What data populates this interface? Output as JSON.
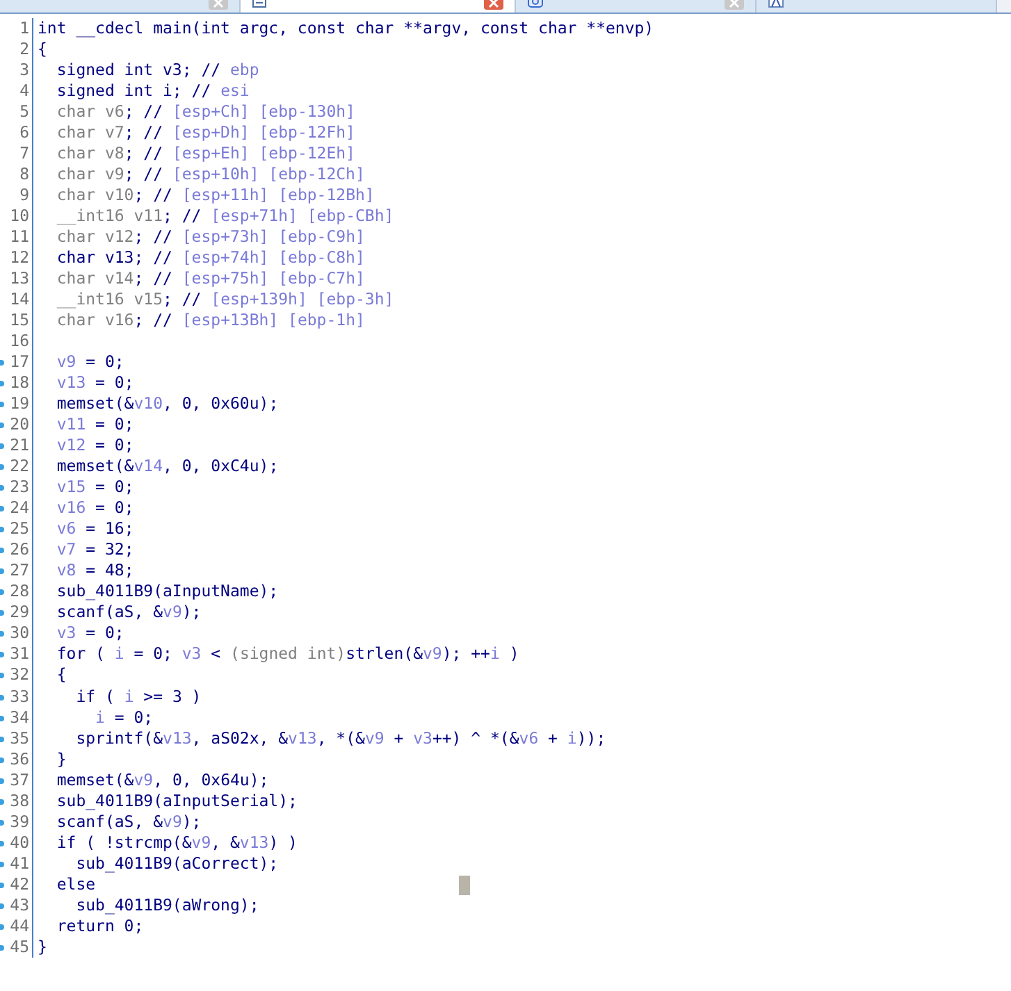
{
  "tabs": [
    {
      "selected": false
    },
    {
      "selected": true
    },
    {
      "selected": false
    },
    {
      "selected": false
    }
  ],
  "lines": [
    {
      "number": "1",
      "marked": false,
      "tokens": [
        {
          "kind": "code",
          "text": "int __cdecl main(int argc, const char **argv, const char **envp)"
        }
      ]
    },
    {
      "number": "2",
      "marked": false,
      "tokens": [
        {
          "kind": "code",
          "text": "{"
        }
      ]
    },
    {
      "number": "3",
      "marked": false,
      "tokens": [
        {
          "kind": "code",
          "text": "  signed int v3; // "
        },
        {
          "kind": "var",
          "text": "ebp"
        }
      ]
    },
    {
      "number": "4",
      "marked": false,
      "tokens": [
        {
          "kind": "code",
          "text": "  signed int i; // "
        },
        {
          "kind": "var",
          "text": "esi"
        }
      ]
    },
    {
      "number": "5",
      "marked": false,
      "tokens": [
        {
          "kind": "dim",
          "text": "  char v6"
        },
        {
          "kind": "code",
          "text": "; // "
        },
        {
          "kind": "var",
          "text": "[esp+Ch] [ebp-130h]"
        }
      ]
    },
    {
      "number": "6",
      "marked": false,
      "tokens": [
        {
          "kind": "dim",
          "text": "  char v7"
        },
        {
          "kind": "code",
          "text": "; // "
        },
        {
          "kind": "var",
          "text": "[esp+Dh] [ebp-12Fh]"
        }
      ]
    },
    {
      "number": "7",
      "marked": false,
      "tokens": [
        {
          "kind": "dim",
          "text": "  char v8"
        },
        {
          "kind": "code",
          "text": "; // "
        },
        {
          "kind": "var",
          "text": "[esp+Eh] [ebp-12Eh]"
        }
      ]
    },
    {
      "number": "8",
      "marked": false,
      "tokens": [
        {
          "kind": "dim",
          "text": "  char v9"
        },
        {
          "kind": "code",
          "text": "; // "
        },
        {
          "kind": "var",
          "text": "[esp+10h] [ebp-12Ch]"
        }
      ]
    },
    {
      "number": "9",
      "marked": false,
      "tokens": [
        {
          "kind": "dim",
          "text": "  char v10"
        },
        {
          "kind": "code",
          "text": "; // "
        },
        {
          "kind": "var",
          "text": "[esp+11h] [ebp-12Bh]"
        }
      ]
    },
    {
      "number": "10",
      "marked": false,
      "tokens": [
        {
          "kind": "dim",
          "text": "  __int16 v11"
        },
        {
          "kind": "code",
          "text": "; // "
        },
        {
          "kind": "var",
          "text": "[esp+71h] [ebp-CBh]"
        }
      ]
    },
    {
      "number": "11",
      "marked": false,
      "tokens": [
        {
          "kind": "dim",
          "text": "  char v12"
        },
        {
          "kind": "code",
          "text": "; // "
        },
        {
          "kind": "var",
          "text": "[esp+73h] [ebp-C9h]"
        }
      ]
    },
    {
      "number": "12",
      "marked": false,
      "tokens": [
        {
          "kind": "code",
          "text": "  char v13; // "
        },
        {
          "kind": "var",
          "text": "[esp+74h] [ebp-C8h]"
        }
      ]
    },
    {
      "number": "13",
      "marked": false,
      "tokens": [
        {
          "kind": "dim",
          "text": "  char v14"
        },
        {
          "kind": "code",
          "text": "; // "
        },
        {
          "kind": "var",
          "text": "[esp+75h] [ebp-C7h]"
        }
      ]
    },
    {
      "number": "14",
      "marked": false,
      "tokens": [
        {
          "kind": "dim",
          "text": "  __int16 v15"
        },
        {
          "kind": "code",
          "text": "; // "
        },
        {
          "kind": "var",
          "text": "[esp+139h] [ebp-3h]"
        }
      ]
    },
    {
      "number": "15",
      "marked": false,
      "tokens": [
        {
          "kind": "dim",
          "text": "  char v16"
        },
        {
          "kind": "code",
          "text": "; // "
        },
        {
          "kind": "var",
          "text": "[esp+13Bh] [ebp-1h]"
        }
      ]
    },
    {
      "number": "16",
      "marked": false
    },
    {
      "number": "17",
      "marked": true,
      "tokens": [
        {
          "kind": "var",
          "text": "  v9"
        },
        {
          "kind": "code",
          "text": " = 0;"
        }
      ]
    },
    {
      "number": "18",
      "marked": true,
      "tokens": [
        {
          "kind": "var",
          "text": "  v13"
        },
        {
          "kind": "code",
          "text": " = 0;"
        }
      ]
    },
    {
      "number": "19",
      "marked": true,
      "tokens": [
        {
          "kind": "code",
          "text": "  memset(&"
        },
        {
          "kind": "var",
          "text": "v10"
        },
        {
          "kind": "code",
          "text": ", 0, 0x60u);"
        }
      ]
    },
    {
      "number": "20",
      "marked": true,
      "tokens": [
        {
          "kind": "var",
          "text": "  v11"
        },
        {
          "kind": "code",
          "text": " = 0;"
        }
      ]
    },
    {
      "number": "21",
      "marked": true,
      "tokens": [
        {
          "kind": "var",
          "text": "  v12"
        },
        {
          "kind": "code",
          "text": " = 0;"
        }
      ]
    },
    {
      "number": "22",
      "marked": true,
      "tokens": [
        {
          "kind": "code",
          "text": "  memset(&"
        },
        {
          "kind": "var",
          "text": "v14"
        },
        {
          "kind": "code",
          "text": ", 0, 0xC4u);"
        }
      ]
    },
    {
      "number": "23",
      "marked": true,
      "tokens": [
        {
          "kind": "var",
          "text": "  v15"
        },
        {
          "kind": "code",
          "text": " = 0;"
        }
      ]
    },
    {
      "number": "24",
      "marked": true,
      "tokens": [
        {
          "kind": "var",
          "text": "  v16"
        },
        {
          "kind": "code",
          "text": " = 0;"
        }
      ]
    },
    {
      "number": "25",
      "marked": true,
      "tokens": [
        {
          "kind": "var",
          "text": "  v6"
        },
        {
          "kind": "code",
          "text": " = 16;"
        }
      ]
    },
    {
      "number": "26",
      "marked": true,
      "tokens": [
        {
          "kind": "var",
          "text": "  v7"
        },
        {
          "kind": "code",
          "text": " = 32;"
        }
      ]
    },
    {
      "number": "27",
      "marked": true,
      "tokens": [
        {
          "kind": "var",
          "text": "  v8"
        },
        {
          "kind": "code",
          "text": " = 48;"
        }
      ]
    },
    {
      "number": "28",
      "marked": true,
      "tokens": [
        {
          "kind": "code",
          "text": "  sub_4011B9(aInputName);"
        }
      ]
    },
    {
      "number": "29",
      "marked": true,
      "tokens": [
        {
          "kind": "code",
          "text": "  scanf(aS, &"
        },
        {
          "kind": "var",
          "text": "v9"
        },
        {
          "kind": "code",
          "text": ");"
        }
      ]
    },
    {
      "number": "30",
      "marked": true,
      "tokens": [
        {
          "kind": "var",
          "text": "  v3"
        },
        {
          "kind": "code",
          "text": " = 0;"
        }
      ]
    },
    {
      "number": "31",
      "marked": true,
      "tokens": [
        {
          "kind": "code",
          "text": "  for ( "
        },
        {
          "kind": "var",
          "text": "i"
        },
        {
          "kind": "code",
          "text": " = 0; "
        },
        {
          "kind": "var",
          "text": "v3"
        },
        {
          "kind": "code",
          "text": " < "
        },
        {
          "kind": "dim",
          "text": "(signed int)"
        },
        {
          "kind": "code",
          "text": "strlen(&"
        },
        {
          "kind": "var",
          "text": "v9"
        },
        {
          "kind": "code",
          "text": "); ++"
        },
        {
          "kind": "var",
          "text": "i"
        },
        {
          "kind": "code",
          "text": " )"
        }
      ]
    },
    {
      "number": "32",
      "marked": true,
      "tokens": [
        {
          "kind": "code",
          "text": "  {"
        }
      ]
    },
    {
      "number": "33",
      "marked": true,
      "tokens": [
        {
          "kind": "code",
          "text": "    if ( "
        },
        {
          "kind": "var",
          "text": "i"
        },
        {
          "kind": "code",
          "text": " >= 3 )"
        }
      ]
    },
    {
      "number": "34",
      "marked": true,
      "tokens": [
        {
          "kind": "var",
          "text": "      i"
        },
        {
          "kind": "code",
          "text": " = 0;"
        }
      ]
    },
    {
      "number": "35",
      "marked": true,
      "tokens": [
        {
          "kind": "code",
          "text": "    sprintf(&"
        },
        {
          "kind": "var",
          "text": "v13"
        },
        {
          "kind": "code",
          "text": ", aS02x, &"
        },
        {
          "kind": "var",
          "text": "v13"
        },
        {
          "kind": "code",
          "text": ", *(&"
        },
        {
          "kind": "var",
          "text": "v9"
        },
        {
          "kind": "code",
          "text": " + "
        },
        {
          "kind": "var",
          "text": "v3"
        },
        {
          "kind": "code",
          "text": "++) ^ *(&"
        },
        {
          "kind": "var",
          "text": "v6"
        },
        {
          "kind": "code",
          "text": " + "
        },
        {
          "kind": "var",
          "text": "i"
        },
        {
          "kind": "code",
          "text": "));"
        }
      ]
    },
    {
      "number": "36",
      "marked": true,
      "tokens": [
        {
          "kind": "code",
          "text": "  }"
        }
      ]
    },
    {
      "number": "37",
      "marked": true,
      "tokens": [
        {
          "kind": "code",
          "text": "  memset(&"
        },
        {
          "kind": "var",
          "text": "v9"
        },
        {
          "kind": "code",
          "text": ", 0, 0x64u);"
        }
      ]
    },
    {
      "number": "38",
      "marked": true,
      "tokens": [
        {
          "kind": "code",
          "text": "  sub_4011B9(aInputSerial);"
        }
      ]
    },
    {
      "number": "39",
      "marked": true,
      "tokens": [
        {
          "kind": "code",
          "text": "  scanf(aS, &"
        },
        {
          "kind": "var",
          "text": "v9"
        },
        {
          "kind": "code",
          "text": ");"
        }
      ]
    },
    {
      "number": "40",
      "marked": true,
      "tokens": [
        {
          "kind": "code",
          "text": "  if ( !strcmp(&"
        },
        {
          "kind": "var",
          "text": "v9"
        },
        {
          "kind": "code",
          "text": ", &"
        },
        {
          "kind": "var",
          "text": "v13"
        },
        {
          "kind": "code",
          "text": ") )"
        }
      ]
    },
    {
      "number": "41",
      "marked": true,
      "tokens": [
        {
          "kind": "code",
          "text": "    sub_4011B9(aCorrect);"
        }
      ]
    },
    {
      "number": "42",
      "marked": true,
      "caret": true,
      "tokens": [
        {
          "kind": "code",
          "text": "  else"
        }
      ]
    },
    {
      "number": "43",
      "marked": true,
      "tokens": [
        {
          "kind": "code",
          "text": "    sub_4011B9(aWrong);"
        }
      ]
    },
    {
      "number": "44",
      "marked": true,
      "tokens": [
        {
          "kind": "code",
          "text": "  return 0;"
        }
      ]
    },
    {
      "number": "45",
      "marked": true,
      "tokens": [
        {
          "kind": "code",
          "text": "}"
        }
      ]
    }
  ]
}
